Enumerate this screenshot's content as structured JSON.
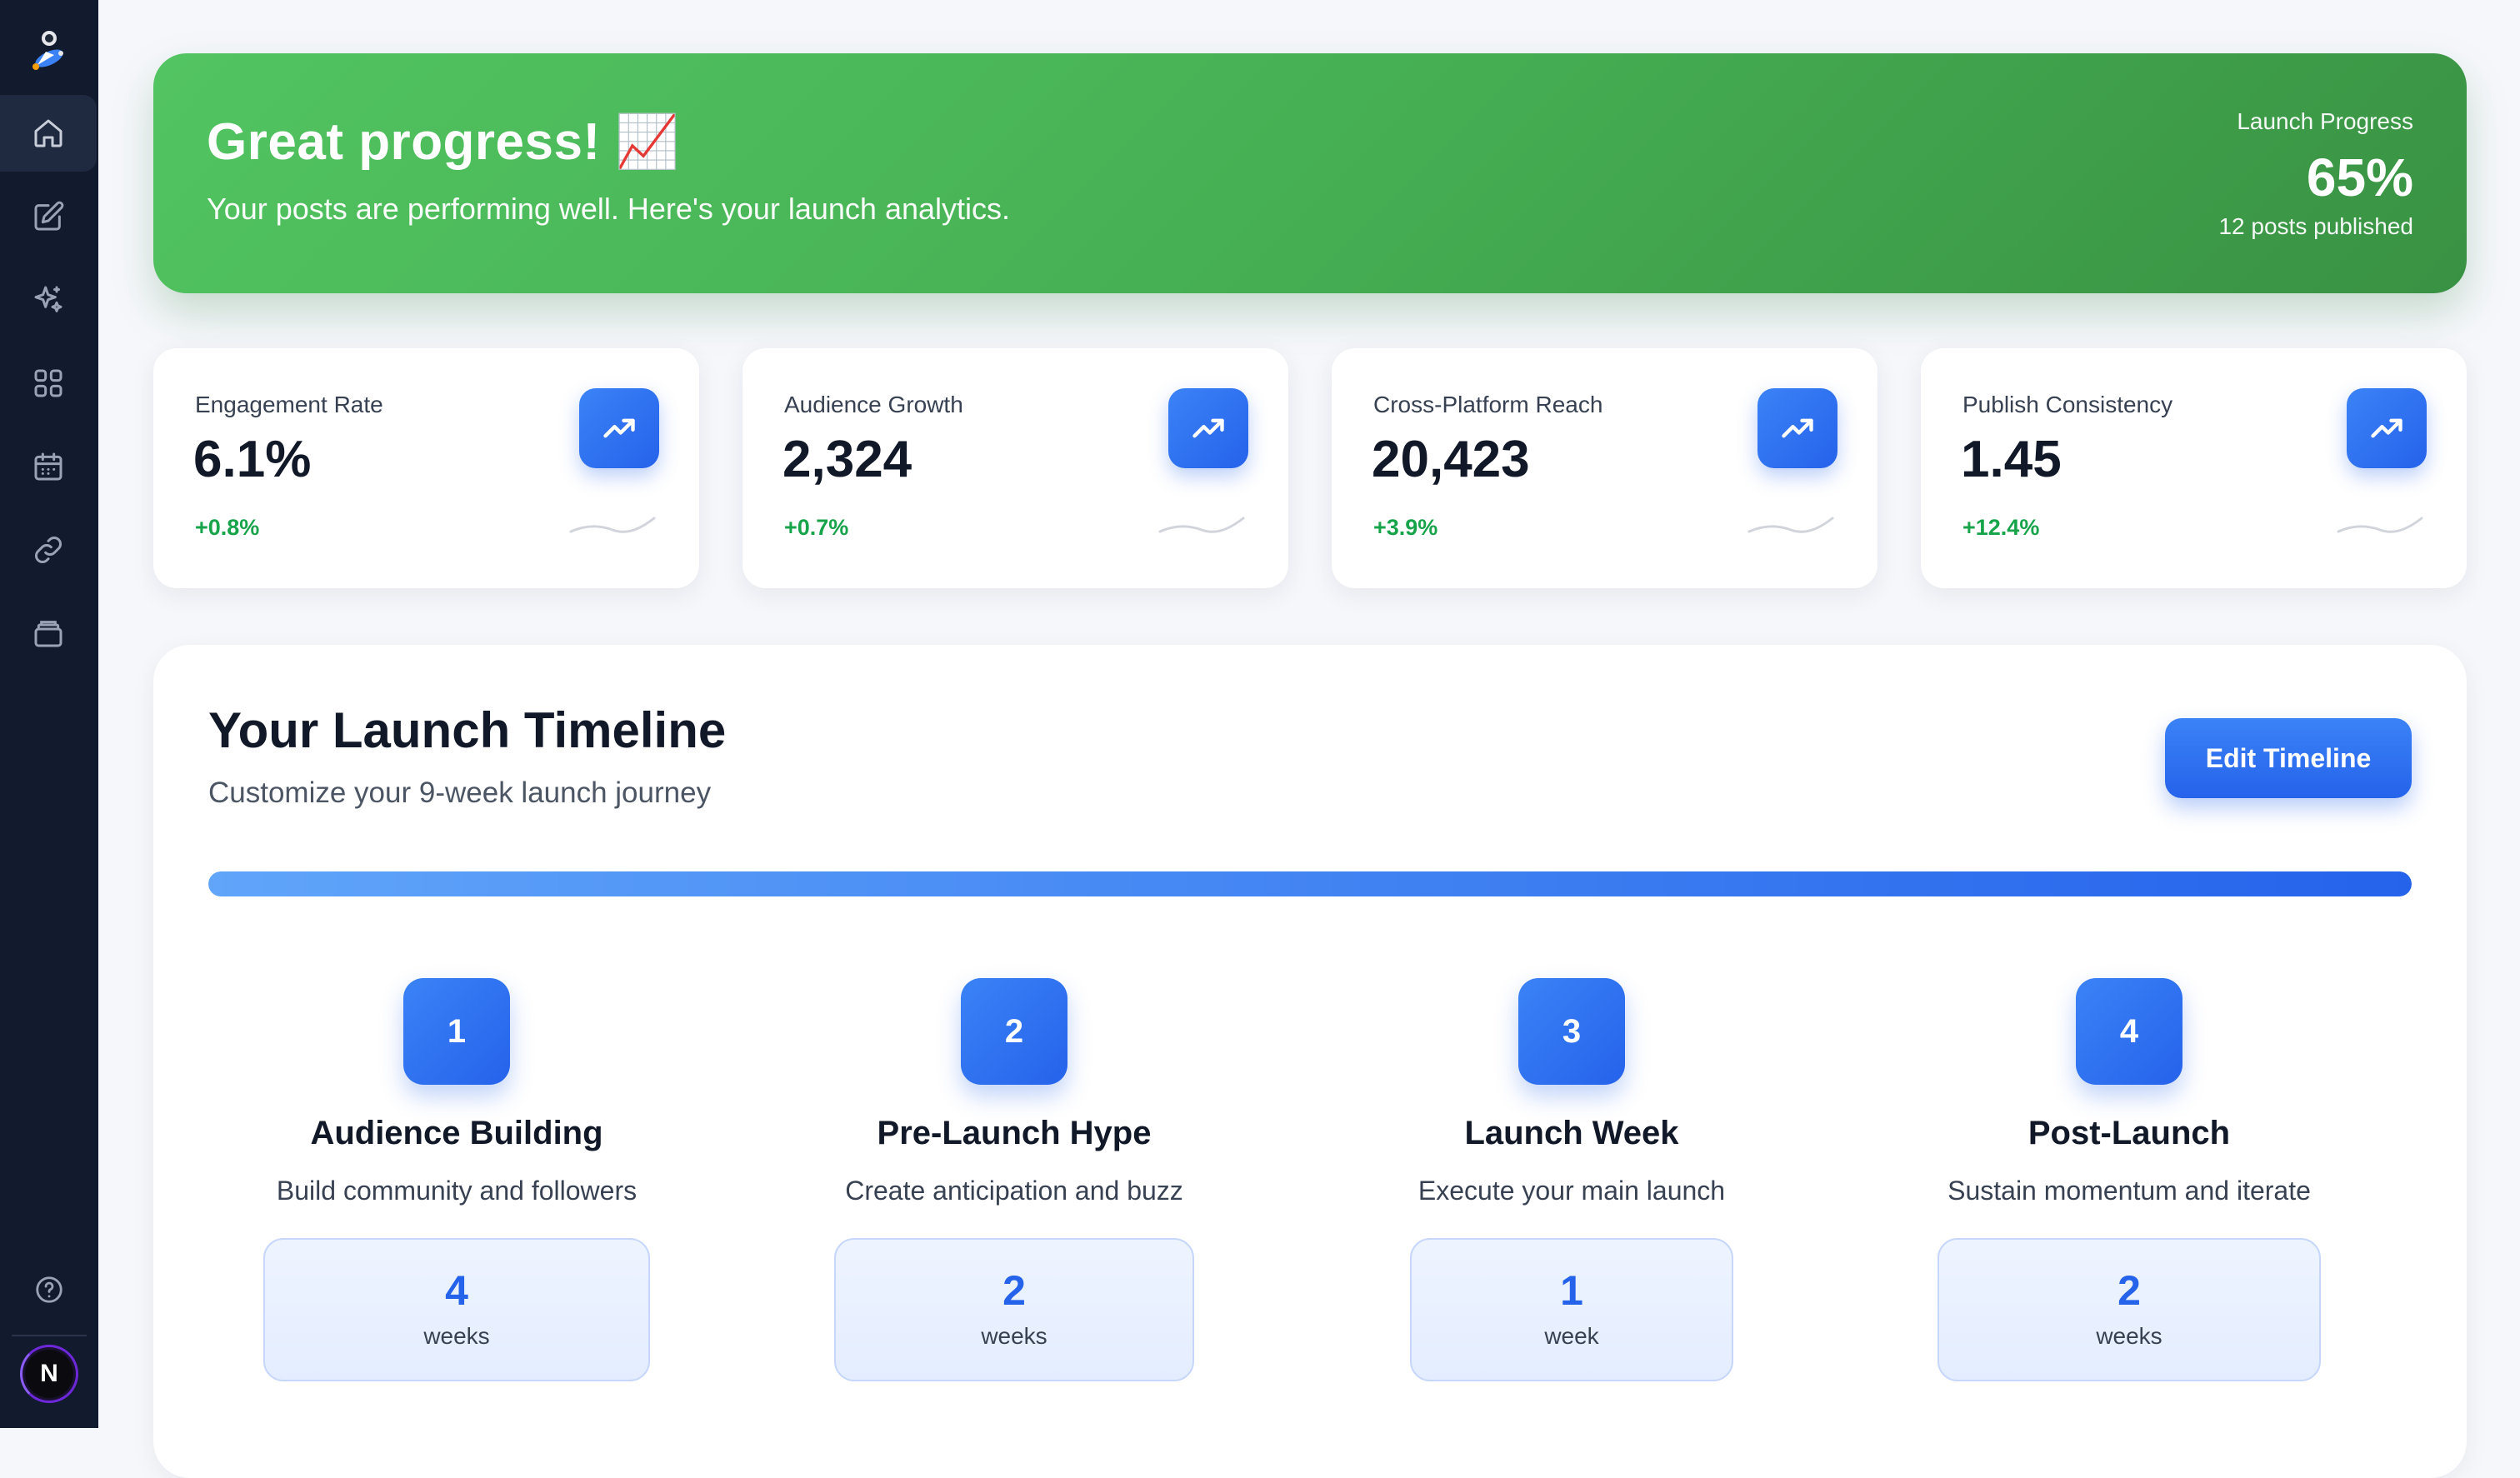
{
  "sidebar": {
    "logo_icon": "rocket-icon",
    "items": [
      {
        "icon": "home-icon",
        "active": true
      },
      {
        "icon": "edit-icon",
        "active": false
      },
      {
        "icon": "sparkles-icon",
        "active": false
      },
      {
        "icon": "grid-icon",
        "active": false
      },
      {
        "icon": "calendar-icon",
        "active": false
      },
      {
        "icon": "link-icon",
        "active": false
      },
      {
        "icon": "layers-icon",
        "active": false
      }
    ],
    "help_icon": "help-icon",
    "avatar_letter": "N"
  },
  "hero": {
    "title": "Great progress! 📈",
    "subtitle": "Your posts are performing well. Here's your launch analytics.",
    "progress_label": "Launch Progress",
    "progress_value": "65%",
    "posts_published": "12 posts published",
    "colors": {
      "start": "#52c461",
      "end": "#399243"
    }
  },
  "stats": [
    {
      "label": "Engagement Rate",
      "value": "6.1%",
      "change": "+0.8%",
      "icon": "trending-up-icon"
    },
    {
      "label": "Audience Growth",
      "value": "2,324",
      "change": "+0.7%",
      "icon": "trending-up-icon"
    },
    {
      "label": "Cross-Platform Reach",
      "value": "20,423",
      "change": "+3.9%",
      "icon": "trending-up-icon"
    },
    {
      "label": "Publish Consistency",
      "value": "1.45",
      "change": "+12.4%",
      "icon": "trending-up-icon"
    }
  ],
  "timeline": {
    "title": "Your Launch Timeline",
    "subtitle": "Customize your 9-week launch journey",
    "edit_label": "Edit Timeline",
    "progress_fraction": 1.0,
    "phases": [
      {
        "number": "1",
        "title": "Audience Building",
        "description": "Build community and followers",
        "duration": "4",
        "unit": "weeks"
      },
      {
        "number": "2",
        "title": "Pre-Launch Hype",
        "description": "Create anticipation and buzz",
        "duration": "2",
        "unit": "weeks"
      },
      {
        "number": "3",
        "title": "Launch Week",
        "description": "Execute your main launch",
        "duration": "1",
        "unit": "week"
      },
      {
        "number": "4",
        "title": "Post-Launch",
        "description": "Sustain momentum and iterate",
        "duration": "2",
        "unit": "weeks"
      }
    ]
  },
  "colors": {
    "accent": "#2563eb",
    "positive": "#16a34a",
    "sidebar": "#121a2e"
  }
}
